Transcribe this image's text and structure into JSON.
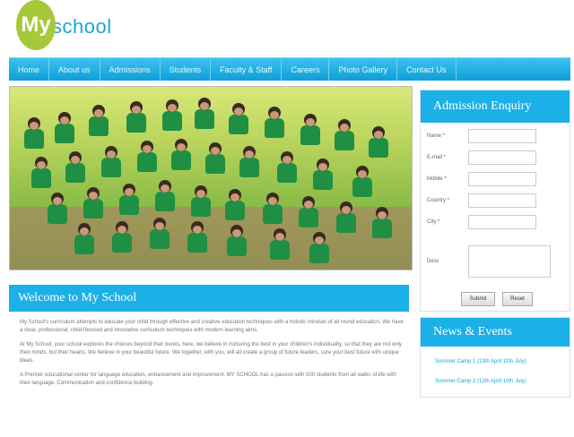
{
  "logo": {
    "badge": "My",
    "text": "school"
  },
  "nav": {
    "items": [
      "Home",
      "About us",
      "Admissions",
      "Students",
      "Faculty & Staff",
      "Careers",
      "Photo Gallery",
      "Contact Us"
    ]
  },
  "welcome": {
    "title": "Welcome to My School",
    "paragraphs": [
      "My School's curriculum attempts to educate your child through effective and creative education techniques with a holistic mindset of all round education. We have a clear, professional, child-focused and innovative curriculum techniques with modern learning aims.",
      "At My School, your school explores the choices beyond their books, here, we believe in nurturing the best in your children's individuality, so that they are not only their minds, but their hearts. We believe in your beautiful future. We together, with you, will all create a group of future leaders, sure your best future with unique ideas.",
      "A Premier educational center for language education, enhancement and improvement. MY SCHOOL has a passion with 500 students from all walks of life with their language. Communication and confidence building."
    ]
  },
  "enquiry": {
    "title": "Admission Enquiry",
    "fields": [
      "Name *",
      "E-mail *",
      "Mobile *",
      "Country *",
      "City *",
      "Desc"
    ],
    "submit_label": "Submit",
    "reset_label": "Reset"
  },
  "news": {
    "title": "News & Events",
    "items": [
      "Summer Camp 1 (19th April 10th July)",
      "Summer Camp 2 (12th April 10th July)"
    ]
  },
  "colors": {
    "accent": "#1cb0e8",
    "logo_green": "#a6c93a",
    "uniform_green": "#1f8f44"
  }
}
